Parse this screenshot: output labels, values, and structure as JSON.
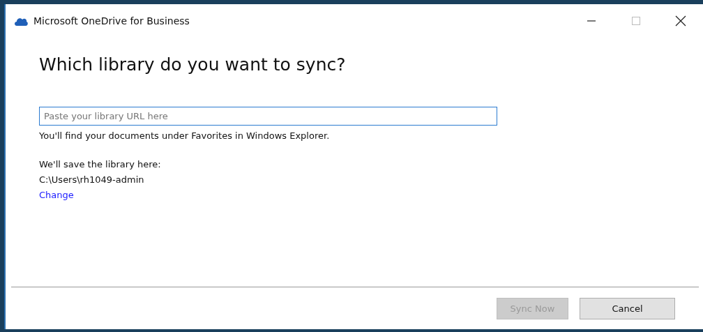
{
  "window": {
    "title": "Microsoft OneDrive for Business"
  },
  "heading": "Which library do you want to sync?",
  "url_field": {
    "placeholder": "Paste your library URL here"
  },
  "hint": "You'll find your documents under Favorites in Windows Explorer.",
  "save_label": "We'll save the library here:",
  "save_path": "C:\\Users\\rh1049-admin",
  "change_link": "Change",
  "buttons": [
    {
      "label": "Sync Now",
      "disabled": true
    },
    {
      "label": "Cancel",
      "disabled": false
    }
  ]
}
